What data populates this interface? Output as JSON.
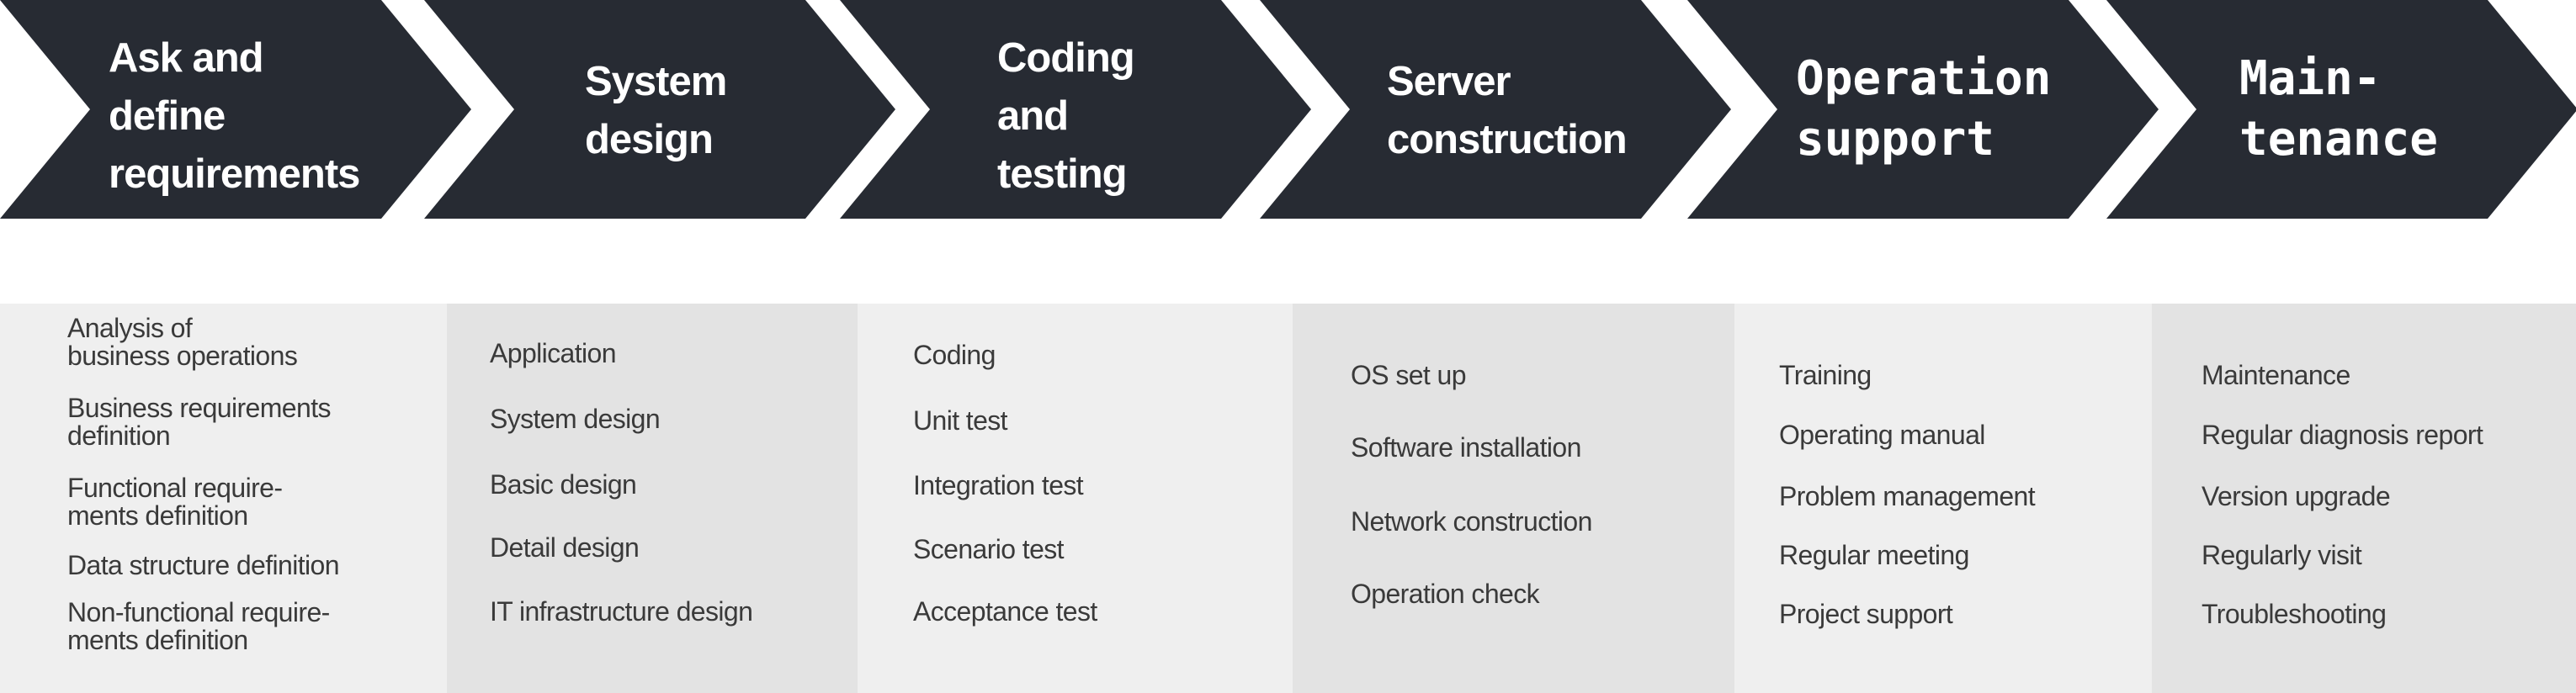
{
  "colors": {
    "chevron": "#272b33",
    "panel_light": "#efefef",
    "panel_dark": "#e3e3e3",
    "heading_text": "#ffffff",
    "item_text": "#3a3a3a"
  },
  "stages": [
    {
      "title": "Ask and\ndefine\nrequirements",
      "items": [
        "Analysis of\nbusiness operations",
        "Business requirements\ndefinition",
        "Functional require-\nments definition",
        "Data structure definition",
        "Non-functional require-\nments definition"
      ]
    },
    {
      "title": "System\ndesign",
      "items": [
        "Application",
        "System design",
        "Basic design",
        "Detail design",
        "IT infrastructure design"
      ]
    },
    {
      "title": "Coding\nand\ntesting",
      "items": [
        "Coding",
        "Unit test",
        "Integration test",
        "Scenario test",
        "Acceptance test"
      ]
    },
    {
      "title": "Server\nconstruction",
      "items": [
        "OS set up",
        "Software installation",
        "Network construction",
        "Operation check"
      ]
    },
    {
      "title": "Operation\nsupport",
      "items": [
        "Training",
        "Operating manual",
        "Problem management",
        "Regular meeting",
        "Project support"
      ]
    },
    {
      "title": "Main-\ntenance",
      "items": [
        "Maintenance",
        "Regular diagnosis report",
        "Version upgrade",
        "Regularly visit",
        "Troubleshooting"
      ]
    }
  ]
}
